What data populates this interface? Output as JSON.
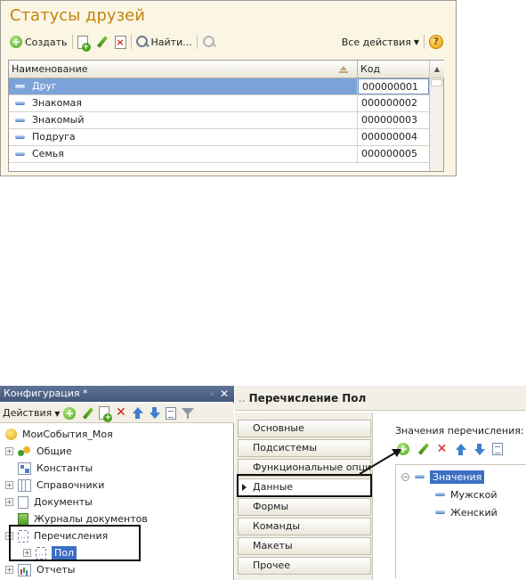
{
  "top": {
    "title": "Статусы друзей",
    "toolbar": {
      "create": "Создать",
      "find": "Найти...",
      "all_actions": "Все действия"
    },
    "table": {
      "columns": [
        "Наименование",
        "Код"
      ],
      "rows": [
        {
          "name": "Друг",
          "code": "000000001"
        },
        {
          "name": "Знакомая",
          "code": "000000002"
        },
        {
          "name": "Знакомый",
          "code": "000000003"
        },
        {
          "name": "Подруга",
          "code": "000000004"
        },
        {
          "name": "Семья",
          "code": "000000005"
        }
      ]
    }
  },
  "config": {
    "title": "Конфигурация *",
    "toolbar_actions": "Действия",
    "tree": {
      "root": "МоиСобытия_Моя",
      "common": "Общие",
      "constants": "Константы",
      "catalogs": "Справочники",
      "documents": "Документы",
      "journals": "Журналы документов",
      "enums": "Перечисления",
      "enum_pol": "Пол",
      "reports": "Отчеты"
    }
  },
  "enum_panel": {
    "title": "Перечисление Пол",
    "tabs": [
      "Основные",
      "Подсистемы",
      "Функциональные опции",
      "Данные",
      "Формы",
      "Команды",
      "Макеты",
      "Прочее"
    ],
    "values_caption": "Значения перечисления:",
    "values_root": "Значения",
    "values": [
      "Мужской",
      "Женский"
    ]
  }
}
